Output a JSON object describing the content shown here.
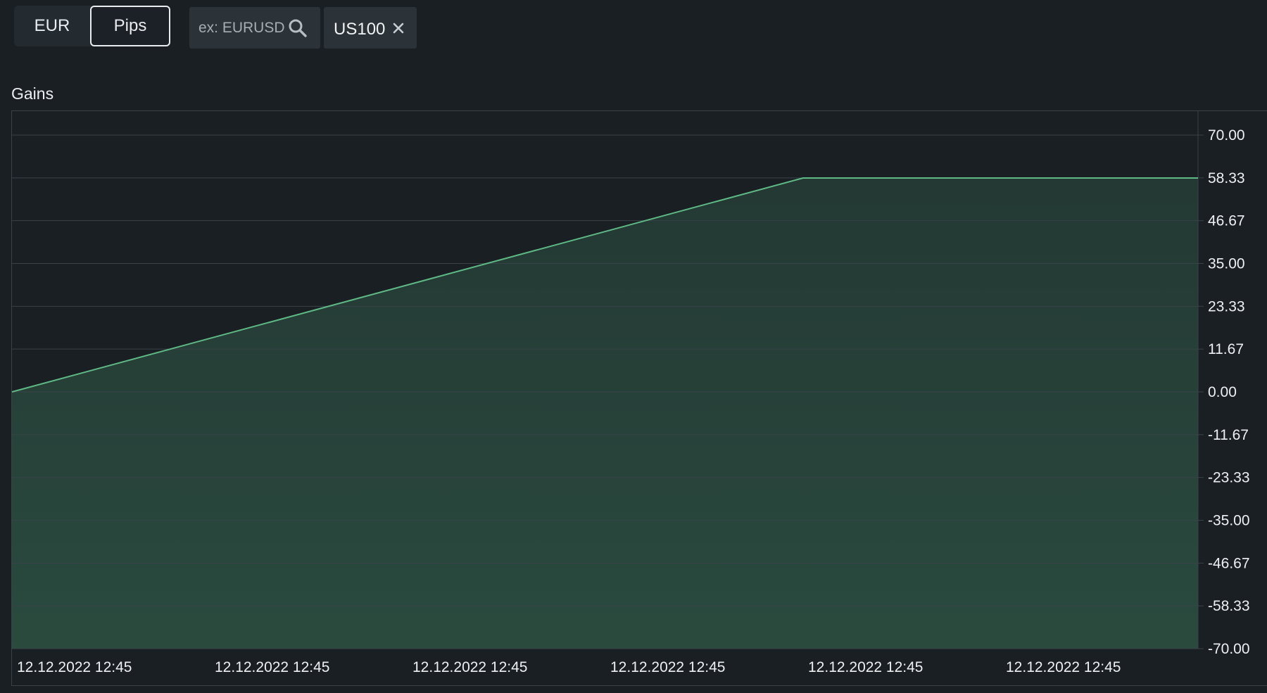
{
  "toolbar": {
    "unit_options": [
      "EUR",
      "Pips"
    ],
    "selected_unit": "Pips",
    "search": {
      "placeholder": "ex: EURUSD",
      "value": ""
    },
    "tags": [
      {
        "label": "US100",
        "close_icon": "close-icon"
      }
    ],
    "icons": {
      "search": "search-icon",
      "close": "close-icon"
    }
  },
  "colors": {
    "background": "#1a1f24",
    "line": "#5fb985",
    "area": "#2b4d40",
    "grid": "#3a4249",
    "text": "#eef0f2"
  },
  "chart_data": {
    "type": "area",
    "title": "Gains",
    "xlabel": "",
    "ylabel": "",
    "ylim": [
      -70.0,
      70.0
    ],
    "y_ticks": [
      "70.00",
      "58.33",
      "46.67",
      "35.00",
      "23.33",
      "11.67",
      "0.00",
      "-11.67",
      "-23.33",
      "-35.00",
      "-46.67",
      "-58.33",
      "-70.00"
    ],
    "x_tick_labels": [
      "12.12.2022 12:45",
      "12.12.2022 12:45",
      "12.12.2022 12:45",
      "12.12.2022 12:45",
      "12.12.2022 12:45",
      "12.12.2022 12:45"
    ],
    "y_axis_position": "right",
    "grid": true,
    "series": [
      {
        "points": [
          {
            "x": 0.0,
            "y": 0.0
          },
          {
            "x": 0.667,
            "y": 58.3
          },
          {
            "x": 1.0,
            "y": 58.3
          }
        ]
      }
    ]
  }
}
